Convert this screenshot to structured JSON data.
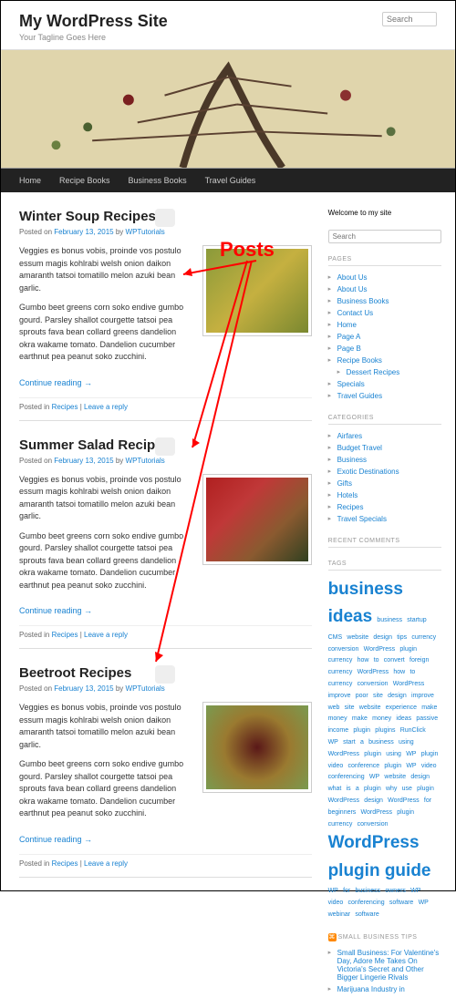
{
  "site": {
    "title": "My WordPress Site",
    "tagline": "Your Tagline Goes Here"
  },
  "search": {
    "placeholder": "Search"
  },
  "nav": [
    "Home",
    "Recipe Books",
    "Business Books",
    "Travel Guides"
  ],
  "posts": [
    {
      "title": "Winter Soup Recipes",
      "date": "February 13, 2015",
      "author": "WPTutorials",
      "p1": "Veggies es bonus vobis, proinde vos postulo essum magis kohlrabi welsh onion daikon amaranth tatsoi tomatillo melon azuki bean garlic.",
      "p2": "Gumbo beet greens corn soko endive gumbo gourd. Parsley shallot courgette tatsoi pea sprouts fava bean collard greens dandelion okra wakame tomato. Dandelion cucumber earthnut pea peanut soko zucchini.",
      "continue": "Continue reading →",
      "posted_in": "Posted in ",
      "cat": "Recipes",
      "sep": " | ",
      "reply": "Leave a reply",
      "thumb_color": "linear-gradient(135deg,#8a9a3a,#c5b040,#7a8830)"
    },
    {
      "title": "Summer Salad Recipes",
      "date": "February 13, 2015",
      "author": "WPTutorials",
      "p1": "Veggies es bonus vobis, proinde vos postulo essum magis kohlrabi welsh onion daikon amaranth tatsoi tomatillo melon azuki bean garlic.",
      "p2": "Gumbo beet greens corn soko endive gumbo gourd. Parsley shallot courgette tatsoi pea sprouts fava bean collard greens dandelion okra wakame tomato. Dandelion cucumber earthnut pea peanut soko zucchini.",
      "continue": "Continue reading →",
      "posted_in": "Posted in ",
      "cat": "Recipes",
      "sep": " | ",
      "reply": "Leave a reply",
      "thumb_color": "linear-gradient(135deg,#b02020,#c03838,#8a5a30,#304020)"
    },
    {
      "title": "Beetroot Recipes",
      "date": "February 13, 2015",
      "author": "WPTutorials",
      "p1": "Veggies es bonus vobis, proinde vos postulo essum magis kohlrabi welsh onion daikon amaranth tatsoi tomatillo melon azuki bean garlic.",
      "p2": "Gumbo beet greens corn soko endive gumbo gourd. Parsley shallot courgette tatsoi pea sprouts fava bean collard greens dandelion okra wakame tomato. Dandelion cucumber earthnut pea peanut soko zucchini.",
      "continue": "Continue reading →",
      "posted_in": "Posted in ",
      "cat": "Recipes",
      "sep": " | ",
      "reply": "Leave a reply",
      "thumb_color": "radial-gradient(circle,#5a1818,#9a7a30,#7a9a50)"
    }
  ],
  "sidebar": {
    "welcome": "Welcome to my site",
    "pages_title": "PAGES",
    "pages": [
      "About Us",
      "About Us",
      "Business Books",
      "Contact Us",
      "Home",
      "Page A",
      "Page B",
      "Recipe Books"
    ],
    "pages_child": "Dessert Recipes",
    "pages_tail": [
      "Specials",
      "Travel Guides"
    ],
    "cats_title": "CATEGORIES",
    "cats": [
      "Airfares",
      "Budget Travel",
      "Business",
      "Exotic Destinations",
      "Gifts",
      "Hotels",
      "Recipes",
      "Travel Specials"
    ],
    "recent_title": "RECENT COMMENTS",
    "tags_title": "TAGS",
    "tag_business": "business ideas",
    "tag_small": "business startup CMS website design tips currency conversion WordPress plugin currency how to convert foreign currency WordPress how to currency conversion WordPress improve poor site design improve web site website experience make money make money ideas passive income plugin plugins RunClick WP start a business using WordPress plugin using WP plugin video conference plugin WP video conferencing WP website design what is a plugin why use plugin WordPress design WordPress for beginners WordPress plugin currency conversion",
    "tag_wp": "WordPress plugin guide",
    "tag_after": "WP for business owners WP video conferencing software WP webinar software",
    "rss_title": "SMALL BUSINESS TIPS",
    "rss_items": [
      "Small Business: For Valentine's Day, Adore Me Takes On Victoria's Secret and Other Bigger Lingerie Rivals",
      "Marijuana Industry in"
    ]
  },
  "annotation": "Posts",
  "meta_labels": {
    "posted_on": "Posted on ",
    "by": " by "
  }
}
